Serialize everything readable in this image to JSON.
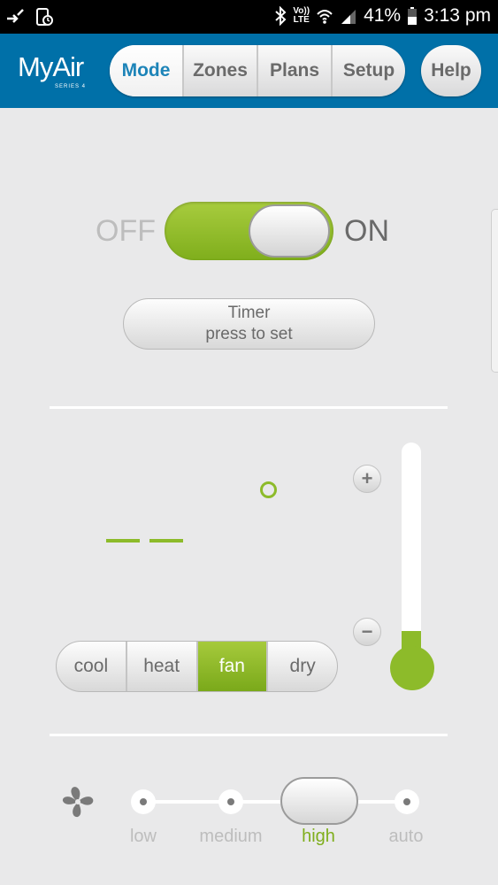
{
  "status_bar": {
    "lte_top": "Vo))",
    "lte_bottom": "LTE",
    "battery": "41%",
    "time": "3:13 pm",
    "icons": [
      "call-forward-icon",
      "screen-clock-icon",
      "bluetooth-icon",
      "wifi-icon",
      "signal-icon",
      "battery-icon"
    ]
  },
  "header": {
    "logo": "MyAir",
    "logo_sub": "SERIES 4",
    "tabs": [
      "Mode",
      "Zones",
      "Plans",
      "Setup"
    ],
    "active_tab": "Mode",
    "help": "Help"
  },
  "power": {
    "off": "OFF",
    "on": "ON",
    "state": "on"
  },
  "timer": {
    "line1": "Timer",
    "line2": "press to set"
  },
  "temperature": {
    "display": "– –",
    "unit_icon": "degree-icon",
    "plus": "+",
    "minus": "−",
    "slider_level": 0.05
  },
  "modes": {
    "items": [
      "cool",
      "heat",
      "fan",
      "dry"
    ],
    "active": "fan"
  },
  "fan_speed": {
    "icon": "fan-icon",
    "options": [
      "low",
      "medium",
      "high",
      "auto"
    ],
    "active": "high"
  },
  "colors": {
    "header_blue": "#0070a8",
    "accent_green": "#8dbb2a",
    "active_tab_text": "#1d84b8"
  }
}
